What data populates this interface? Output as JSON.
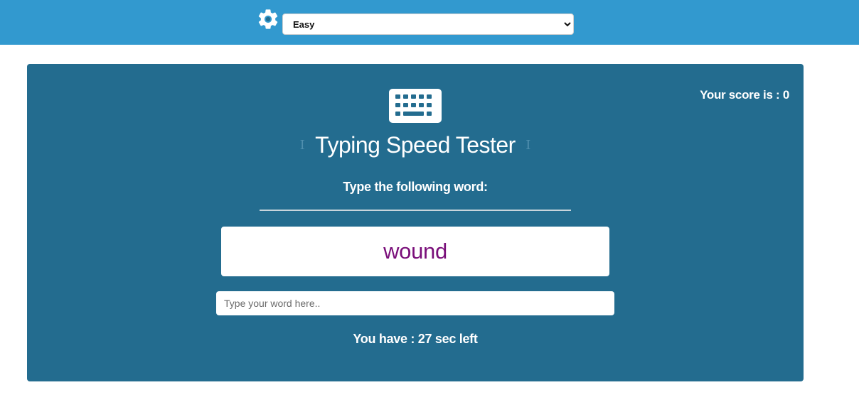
{
  "header": {
    "settings_icon": "gear-icon",
    "difficulty": {
      "selected": "Easy",
      "options": [
        "Easy"
      ]
    }
  },
  "card": {
    "score_text": "Your score is : 0",
    "icon": "keyboard-icon",
    "cursor_left": "I",
    "title": "Typing Speed Tester",
    "cursor_right": "I",
    "prompt": "Type the following word:",
    "current_word": "wound",
    "input": {
      "placeholder": "Type your word here..",
      "value": ""
    },
    "timer_text": "You have : 27 sec left"
  },
  "colors": {
    "header_bg": "#3299cf",
    "card_bg": "#236c8f",
    "word_color": "#7a0f7a",
    "text_on_card": "#ffffff"
  }
}
